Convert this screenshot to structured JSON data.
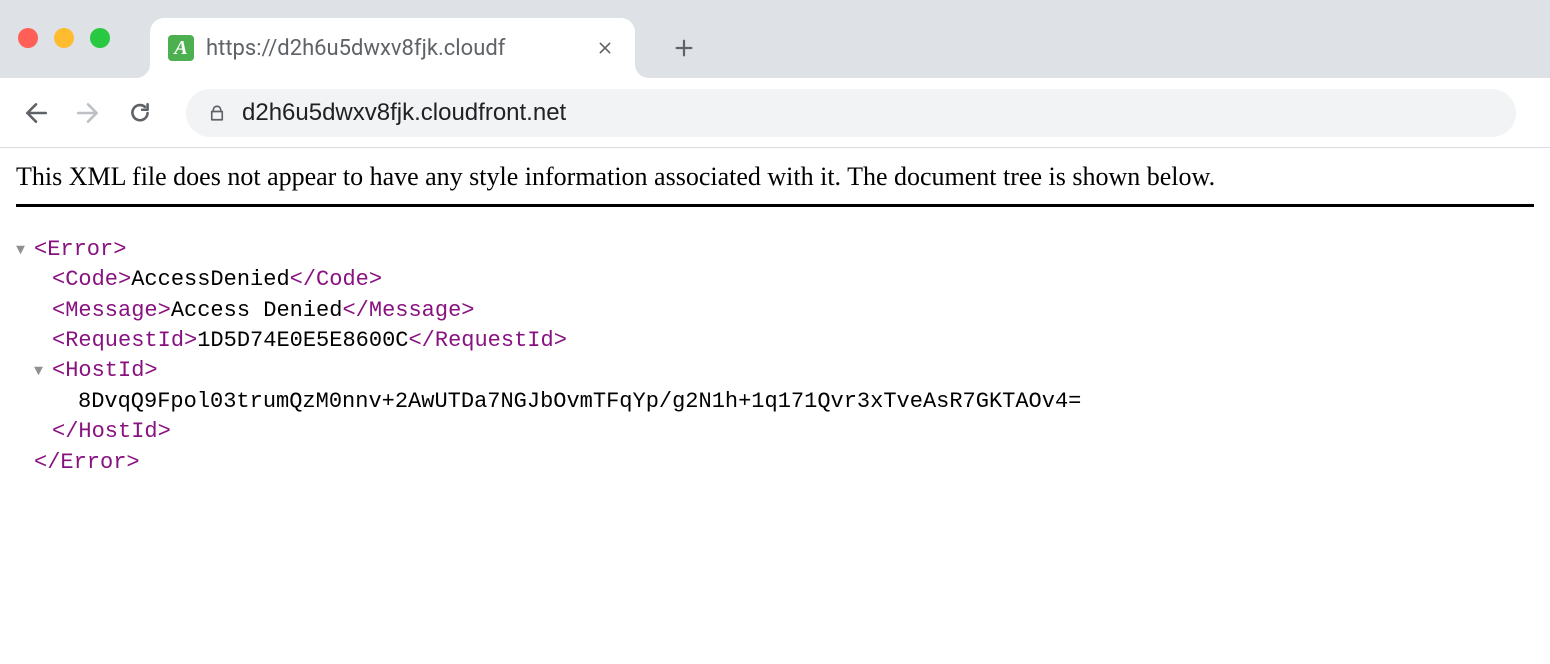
{
  "browser": {
    "tab_title": "https://d2h6u5dwxv8fjk.cloudf",
    "favicon_letter": "A",
    "url_display": "d2h6u5dwxv8fjk.cloudfront.net"
  },
  "xml": {
    "banner": "This XML file does not appear to have any style information associated with it. The document tree is shown below.",
    "root_open": "<Error>",
    "root_close": "</Error>",
    "code_open": "<Code>",
    "code_val": "AccessDenied",
    "code_close": "</Code>",
    "msg_open": "<Message>",
    "msg_val": "Access Denied",
    "msg_close": "</Message>",
    "req_open": "<RequestId>",
    "req_val": "1D5D74E0E5E8600C",
    "req_close": "</RequestId>",
    "host_open": "<HostId>",
    "host_val": "8DvqQ9Fpol03trumQzM0nnv+2AwUTDa7NGJbOvmTFqYp/g2N1h+1q171Qvr3xTveAsR7GKTAOv4=",
    "host_close": "</HostId>"
  }
}
